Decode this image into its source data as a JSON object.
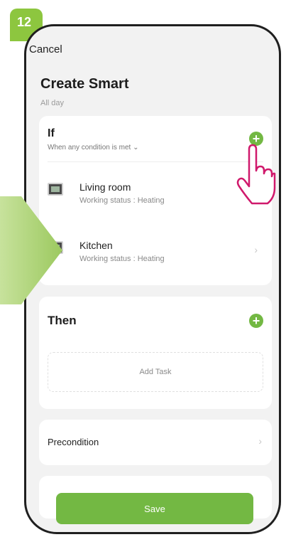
{
  "step_number": "12",
  "header": {
    "cancel_label": "Cancel",
    "title": "Create Smart",
    "subtitle": "All day"
  },
  "if_section": {
    "title": "If",
    "condition_label": "When any condition is met",
    "condition_chevron": "⌄",
    "add_icon": "plus-icon",
    "devices": [
      {
        "name": "Living room",
        "status": "Working status : Heating"
      },
      {
        "name": "Kitchen",
        "status": "Working status : Heating",
        "chevron": "›"
      }
    ]
  },
  "then_section": {
    "title": "Then",
    "add_icon": "plus-icon",
    "add_task_label": "Add Task"
  },
  "precondition": {
    "label": "Precondition",
    "chevron": "›"
  },
  "save_label": "Save",
  "colors": {
    "accent": "#73b843",
    "badge": "#8dc63f",
    "hand": "#d0196c"
  }
}
